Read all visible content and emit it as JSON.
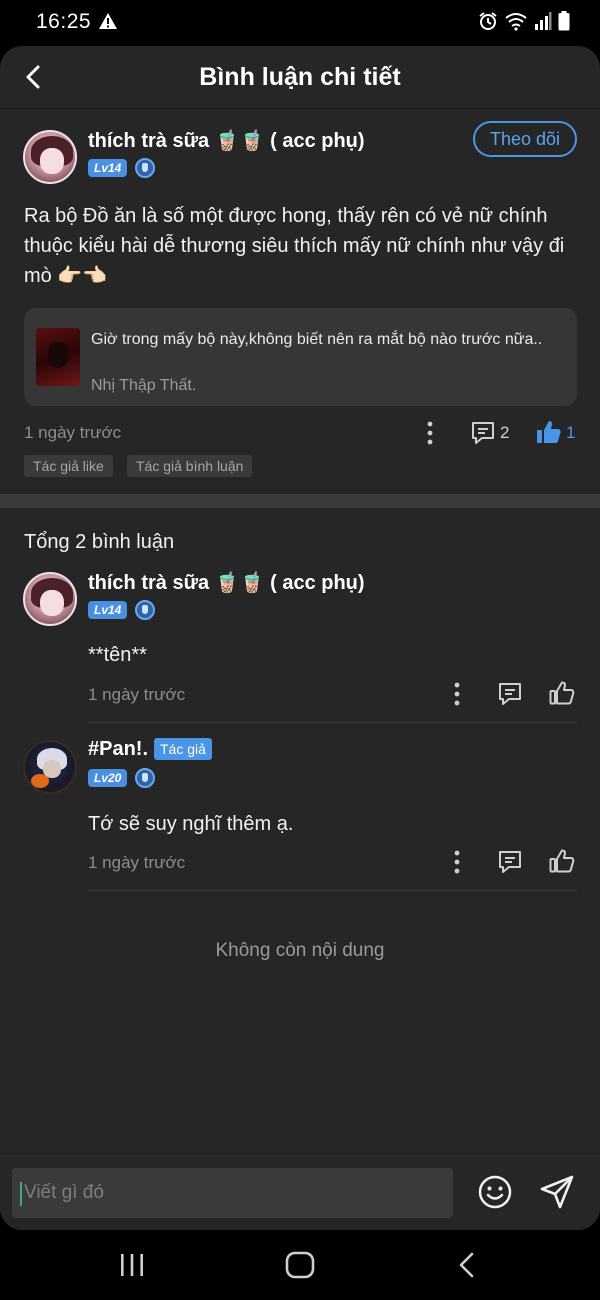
{
  "status_bar": {
    "time": "16:25"
  },
  "header": {
    "title": "Bình luận chi tiết"
  },
  "post": {
    "username": "thích trà sữa 🧋🧋 ( acc phụ)",
    "level": "Lv14",
    "follow_label": "Theo dõi",
    "text": "Ra bộ Đồ ăn là số một được hong, thấy rên có vẻ nữ chính thuộc kiểu hài dễ thương siêu thích mấy nữ chính như vậy đi mò 👉🏻👈🏻",
    "book": {
      "title": "Giờ trong mấy bộ này,không biết nên ra mắt bộ nào trước nữa..",
      "author": "Nhị Thập Thất."
    },
    "time": "1 ngày trước",
    "comment_count": "2",
    "like_count": "1",
    "tags": [
      "Tác giả like",
      "Tác giả bình luận"
    ]
  },
  "comments_section": {
    "total_label": "Tổng 2 bình luận",
    "comments": [
      {
        "username": "thích trà sữa 🧋🧋 ( acc phụ)",
        "level": "Lv14",
        "text": "**tên**",
        "time": "1 ngày trước"
      },
      {
        "username": "#Pan!.",
        "author_tag": "Tác giả",
        "level": "Lv20",
        "text": "Tớ sẽ suy nghĩ thêm ạ.",
        "time": "1 ngày trước"
      }
    ],
    "end_label": "Không còn nội dung"
  },
  "input": {
    "placeholder": "Viết gì đó"
  },
  "colors": {
    "accent": "#4a95e8",
    "background": "#262626",
    "card": "#363636"
  }
}
